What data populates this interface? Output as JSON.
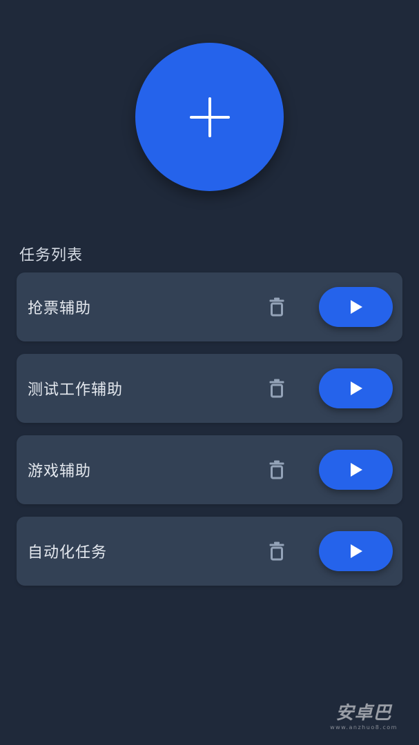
{
  "fab": {
    "icon": "plus-icon",
    "color": "#2563eb"
  },
  "section_title": "任务列表",
  "tasks": [
    {
      "name": "抢票辅助",
      "delete_icon": "trash-icon",
      "run_icon": "play-icon"
    },
    {
      "name": "测试工作辅助",
      "delete_icon": "trash-icon",
      "run_icon": "play-icon"
    },
    {
      "name": "游戏辅助",
      "delete_icon": "trash-icon",
      "run_icon": "play-icon"
    },
    {
      "name": "自动化任务",
      "delete_icon": "trash-icon",
      "run_icon": "play-icon"
    }
  ],
  "watermark": {
    "title": "安卓巴",
    "url": "www.anzhuo8.com"
  },
  "colors": {
    "background": "#1f293a",
    "card": "#334155",
    "accent": "#2563eb",
    "icon_muted": "#94a3b8"
  }
}
